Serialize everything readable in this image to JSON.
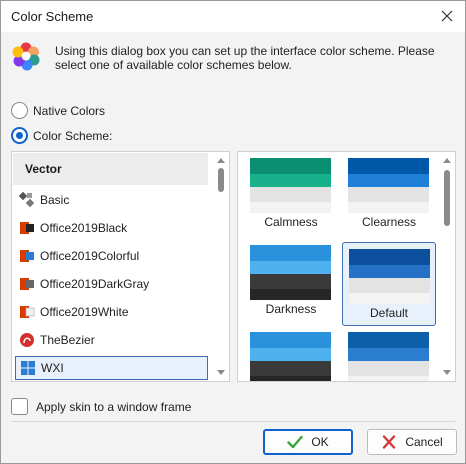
{
  "window": {
    "title": "Color Scheme"
  },
  "description": "Using this dialog box you can set up the interface color scheme. Please select one of available color schemes below.",
  "options": {
    "native_label": "Native Colors",
    "scheme_label": "Color Scheme:"
  },
  "list": {
    "header": "Vector",
    "items": [
      {
        "label": "Basic",
        "icon": "basic-skin-icon"
      },
      {
        "label": "Office2019Black",
        "icon": "office-black-icon"
      },
      {
        "label": "Office2019Colorful",
        "icon": "office-colorful-icon"
      },
      {
        "label": "Office2019DarkGray",
        "icon": "office-darkgray-icon"
      },
      {
        "label": "Office2019White",
        "icon": "office-white-icon"
      },
      {
        "label": "TheBezier",
        "icon": "bezier-icon"
      },
      {
        "label": "WXI",
        "icon": "windows-icon"
      }
    ],
    "selected": "WXI"
  },
  "schemes": [
    {
      "label": "Calmness",
      "colors": [
        "#0a8f72",
        "#17b18c",
        "#e3e3e3",
        "#f3f3f3"
      ]
    },
    {
      "label": "Clearness",
      "colors": [
        "#0058a8",
        "#1f7ed6",
        "#e3e3e3",
        "#f3f3f3"
      ]
    },
    {
      "label": "Darkness",
      "colors": [
        "#2a91dd",
        "#4fb1ee",
        "#3a3a3a",
        "#262626"
      ]
    },
    {
      "label": "Default",
      "colors": [
        "#0c4f9c",
        "#2671c8",
        "#e3e3e3",
        "#f3f3f3"
      ]
    },
    {
      "label": "",
      "colors": [
        "#2a91dd",
        "#4fb1ee",
        "#3a3a3a",
        "#262626"
      ]
    },
    {
      "label": "",
      "colors": [
        "#0c5fa8",
        "#2b7dd0",
        "#e3e3e3",
        "#f3f3f3"
      ]
    }
  ],
  "selected_scheme": "Default",
  "checkbox": {
    "label": "Apply skin to a window frame",
    "checked": false
  },
  "buttons": {
    "ok": "OK",
    "cancel": "Cancel"
  },
  "colors": {
    "accent": "#0f62c9",
    "ok_check": "#3aa53a",
    "cancel_x": "#d23a3a"
  }
}
